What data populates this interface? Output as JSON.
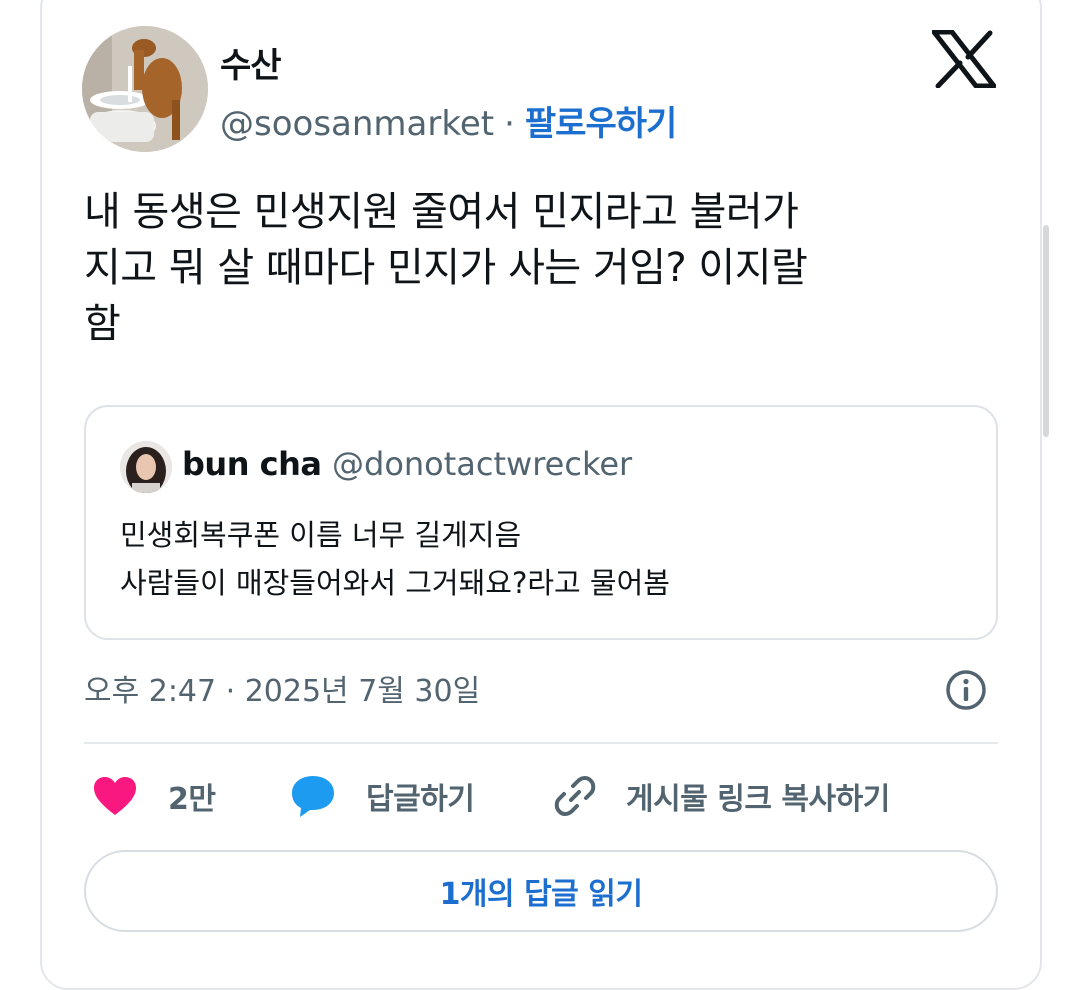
{
  "author": {
    "name": "수산",
    "handle": "@soosanmarket",
    "separator": "·",
    "follow_label": "팔로우하기"
  },
  "tweet": {
    "text_lines": [
      "내 동생은 민생지원 줄여서 민지라고 불러가",
      "지고 뭐 살 때마다 민지가 사는 거임? 이지랄",
      "함"
    ]
  },
  "quoted": {
    "name": "bun cha",
    "handle": "@donotactwrecker",
    "text_lines": [
      "민생회복쿠폰 이름 너무 길게지음",
      "사람들이 매장들어와서 그거돼요?라고 물어봄"
    ]
  },
  "timestamp": "오후 2:47 · 2025년 7월 30일",
  "actions": {
    "like_count": "2만",
    "reply_label": "답글하기",
    "copy_link_label": "게시물 링크 복사하기"
  },
  "read_replies_label": "1개의 답글 읽기",
  "icons": {
    "platform": "x-logo-icon",
    "info": "info-icon",
    "like": "heart-icon",
    "reply": "speech-bubble-icon",
    "copy": "link-icon"
  },
  "colors": {
    "accent_blue": "#1d6fcf",
    "heart_pink": "#f91880",
    "reply_blue": "#1d9bf0",
    "secondary_text": "#536471"
  }
}
